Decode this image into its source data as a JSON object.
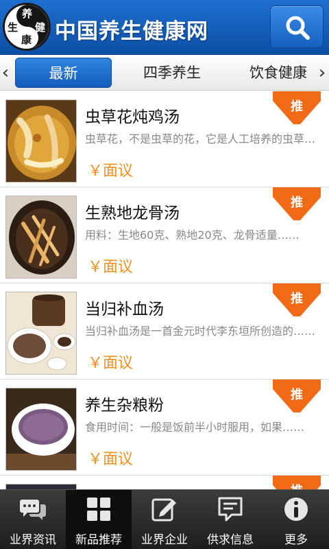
{
  "header": {
    "logo_chars": [
      "养",
      "健",
      "生",
      "康"
    ],
    "site_title": "中国养生健康网",
    "search_icon": "search-icon"
  },
  "tabs": {
    "left_arrow": "‹",
    "right_arrow": "›",
    "items": [
      {
        "label": "最新",
        "active": true
      },
      {
        "label": "四季养生",
        "active": false
      },
      {
        "label": "饮食健康",
        "active": false
      }
    ]
  },
  "list": {
    "items": [
      {
        "title": "虫草花炖鸡汤",
        "desc": "虫草花，不是虫草的花，它是人工培养的虫草子实体……",
        "price": "￥面议",
        "badge": "推"
      },
      {
        "title": "生熟地龙骨汤",
        "desc": "用料：生地60克、熟地20克、龙骨适量……",
        "price": "￥面议",
        "badge": "推"
      },
      {
        "title": "当归补血汤",
        "desc": "当归补血汤是一首金元时代李东垣所创造的……",
        "price": "￥面议",
        "badge": "推"
      },
      {
        "title": "养生杂粮粉",
        "desc": "食用时间：一般是饭前半小时服用，如果……",
        "price": "￥面议",
        "badge": "推"
      },
      {
        "title": "",
        "desc": "",
        "price": "",
        "badge": "推"
      }
    ]
  },
  "bottom_nav": {
    "items": [
      {
        "label": "业界资讯",
        "icon": "chat-bubbles-icon",
        "active": false
      },
      {
        "label": "新品推荐",
        "icon": "grid-icon",
        "active": true
      },
      {
        "label": "业界企业",
        "icon": "edit-icon",
        "active": false
      },
      {
        "label": "供求信息",
        "icon": "message-icon",
        "active": false
      },
      {
        "label": "更多",
        "icon": "info-icon",
        "active": false
      }
    ]
  },
  "colors": {
    "header_blue": "#0c4fa6",
    "accent_orange": "#f0901f",
    "badge_orange": "#f26a16"
  }
}
